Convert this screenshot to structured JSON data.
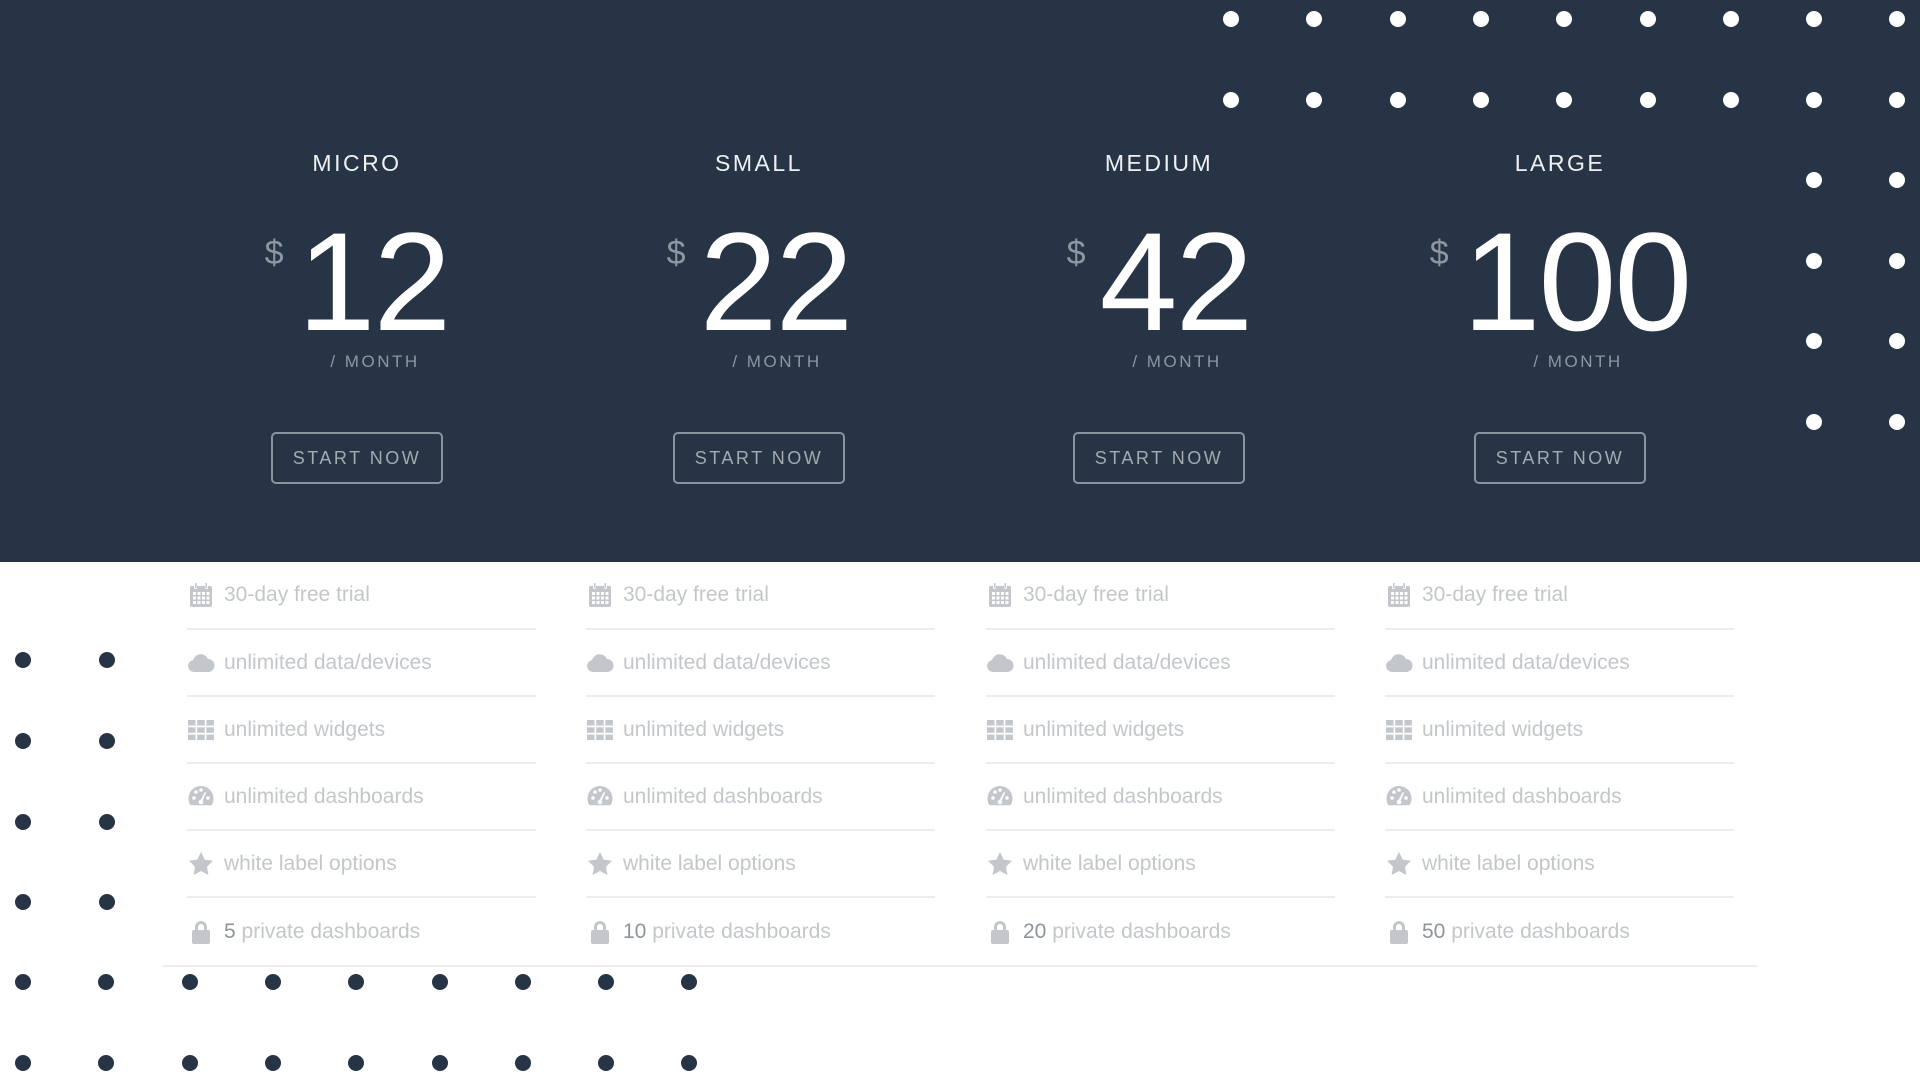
{
  "colors": {
    "hero_bg": "#263445",
    "feature_text": "#c3c6cb",
    "feature_number": "#8f949b",
    "button_border": "#8a939e",
    "dot_light": "#ffffff",
    "dot_dark": "#263445"
  },
  "plans": [
    {
      "name": "MICRO",
      "currency": "$",
      "price": "12",
      "period": "/ MONTH",
      "cta": "START NOW",
      "features": [
        {
          "icon": "calendar-icon",
          "number": "",
          "text": "30-day free trial"
        },
        {
          "icon": "cloud-icon",
          "number": "",
          "text": "unlimited data/devices"
        },
        {
          "icon": "grid-icon",
          "number": "",
          "text": "unlimited widgets"
        },
        {
          "icon": "dashboard-gauge-icon",
          "number": "",
          "text": "unlimited dashboards"
        },
        {
          "icon": "star-icon",
          "number": "",
          "text": "white label options"
        },
        {
          "icon": "lock-icon",
          "number": "5",
          "text": "private dashboards"
        }
      ]
    },
    {
      "name": "SMALL",
      "currency": "$",
      "price": "22",
      "period": "/ MONTH",
      "cta": "START NOW",
      "features": [
        {
          "icon": "calendar-icon",
          "number": "",
          "text": "30-day free trial"
        },
        {
          "icon": "cloud-icon",
          "number": "",
          "text": "unlimited data/devices"
        },
        {
          "icon": "grid-icon",
          "number": "",
          "text": "unlimited widgets"
        },
        {
          "icon": "dashboard-gauge-icon",
          "number": "",
          "text": "unlimited dashboards"
        },
        {
          "icon": "star-icon",
          "number": "",
          "text": "white label options"
        },
        {
          "icon": "lock-icon",
          "number": "10",
          "text": "private dashboards"
        }
      ]
    },
    {
      "name": "MEDIUM",
      "currency": "$",
      "price": "42",
      "period": "/ MONTH",
      "cta": "START NOW",
      "features": [
        {
          "icon": "calendar-icon",
          "number": "",
          "text": "30-day free trial"
        },
        {
          "icon": "cloud-icon",
          "number": "",
          "text": "unlimited data/devices"
        },
        {
          "icon": "grid-icon",
          "number": "",
          "text": "unlimited widgets"
        },
        {
          "icon": "dashboard-gauge-icon",
          "number": "",
          "text": "unlimited dashboards"
        },
        {
          "icon": "star-icon",
          "number": "",
          "text": "white label options"
        },
        {
          "icon": "lock-icon",
          "number": "20",
          "text": "private dashboards"
        }
      ]
    },
    {
      "name": "LARGE",
      "currency": "$",
      "price": "100",
      "period": "/ MONTH",
      "cta": "START NOW",
      "features": [
        {
          "icon": "calendar-icon",
          "number": "",
          "text": "30-day free trial"
        },
        {
          "icon": "cloud-icon",
          "number": "",
          "text": "unlimited data/devices"
        },
        {
          "icon": "grid-icon",
          "number": "",
          "text": "unlimited widgets"
        },
        {
          "icon": "dashboard-gauge-icon",
          "number": "",
          "text": "unlimited dashboards"
        },
        {
          "icon": "star-icon",
          "number": "",
          "text": "white label options"
        },
        {
          "icon": "lock-icon",
          "number": "50",
          "text": "private dashboards"
        }
      ]
    }
  ]
}
